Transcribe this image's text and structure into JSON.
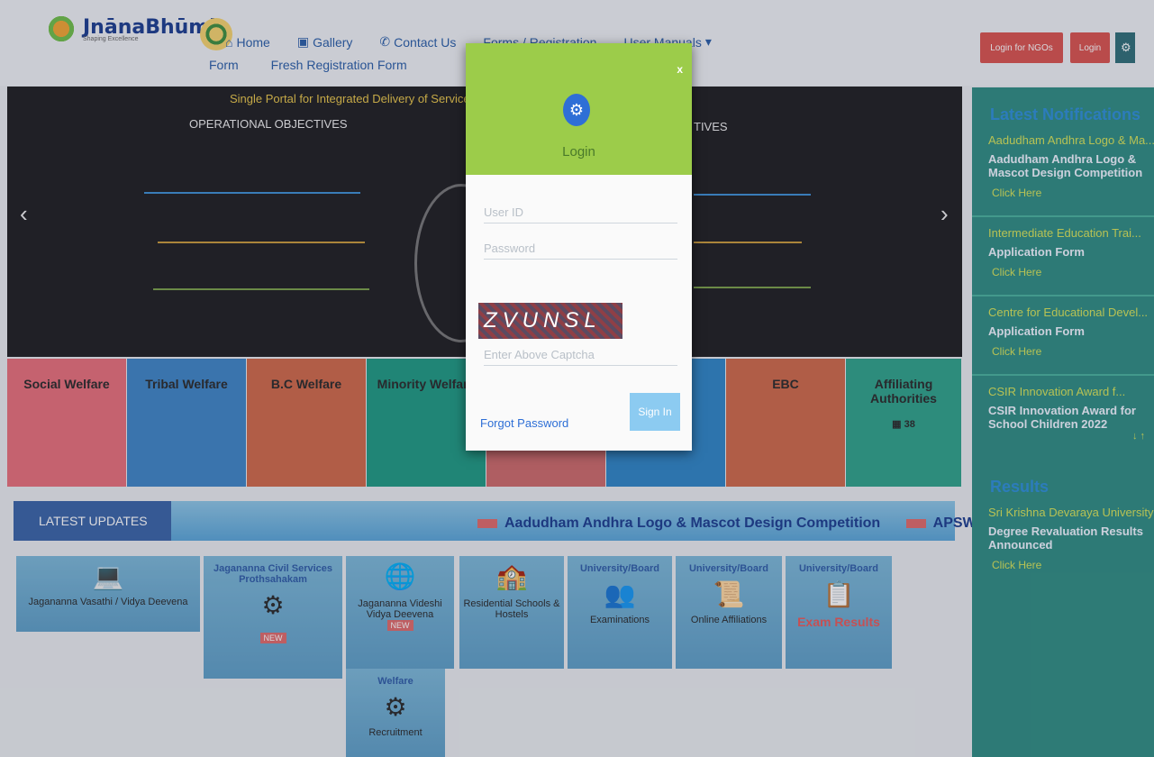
{
  "header": {
    "logo_text": "JnānaBhūmi",
    "logo_tagline": "Shaping Excellence",
    "nav": [
      "Home",
      "Gallery",
      "Contact Us",
      "Forms / Registration",
      "User Manuals"
    ],
    "nav_second": [
      "Form",
      "Fresh Registration Form"
    ],
    "login_for_ngo": "Login for NGOs",
    "login": "Login"
  },
  "slider": {
    "banner_title": "Single Portal for Integrated Delivery of Services",
    "left_heading": "OPERATIONAL OBJECTIVES",
    "right_heading": "TIVES"
  },
  "tiles": [
    {
      "label": "Social Welfare",
      "color": "#e8707a"
    },
    {
      "label": "Tribal Welfare",
      "color": "#3f86c6"
    },
    {
      "label": "B.C Welfare",
      "color": "#d06a4a"
    },
    {
      "label": "Minority Welfare",
      "color": "#1f9a83"
    },
    {
      "label": "",
      "color": "#cd6b6b"
    },
    {
      "label": "",
      "color": "#2f85c6"
    },
    {
      "label": "EBC",
      "color": "#cf6a4a"
    },
    {
      "label": "Affiliating Authorities",
      "color": "#2fa38a"
    }
  ],
  "affiliating_count": "38",
  "updates": {
    "label": "LATEST UPDATES",
    "ticker_1": "Aadudham Andhra Logo & Mascot Design Competition",
    "ticker_2": "APSWREIS"
  },
  "cards": [
    {
      "title": "",
      "text": "Jagananna Vasathi / Vidya Deevena"
    },
    {
      "title": "Jagananna Civil Services Prothsahakam",
      "text": ""
    },
    {
      "title": "",
      "text": "Jagananna Videshi Vidya Deevena"
    },
    {
      "title": "",
      "text": "Residential Schools & Hostels"
    },
    {
      "title": "University/Board",
      "text": "Examinations"
    },
    {
      "title": "University/Board",
      "text": "Online Affiliations"
    },
    {
      "title": "University/Board",
      "text": "Exam Results"
    },
    {
      "title": "Welfare",
      "text": "Recruitment"
    }
  ],
  "new_badge": "NEW",
  "sidebar": {
    "notifications_title": "Latest Notifications",
    "items": [
      {
        "title": "Aadudham Andhra Logo & Ma...",
        "desc": "Aadudham Andhra Logo & Mascot Design Competition",
        "link": "Click Here"
      },
      {
        "title": "Intermediate Education Trai...",
        "desc": "Application Form",
        "link": "Click Here"
      },
      {
        "title": "Centre for Educational Devel...",
        "desc": "Application Form",
        "link": "Click Here"
      },
      {
        "title": "CSIR Innovation Award f...",
        "desc": "CSIR Innovation Award for School Children 2022",
        "link": ""
      }
    ],
    "results_title": "Results",
    "result_item": {
      "title": "Sri Krishna Devaraya University",
      "desc": "Degree Revaluation Results Announced",
      "link": "Click Here"
    }
  },
  "modal": {
    "close": "x",
    "title": "Login",
    "user_id_placeholder": "User ID",
    "password_placeholder": "Password",
    "captcha_text": "ZVUNSL",
    "captcha_placeholder": "Enter Above Captcha",
    "forgot": "Forgot Password",
    "signin": "Sign In"
  }
}
